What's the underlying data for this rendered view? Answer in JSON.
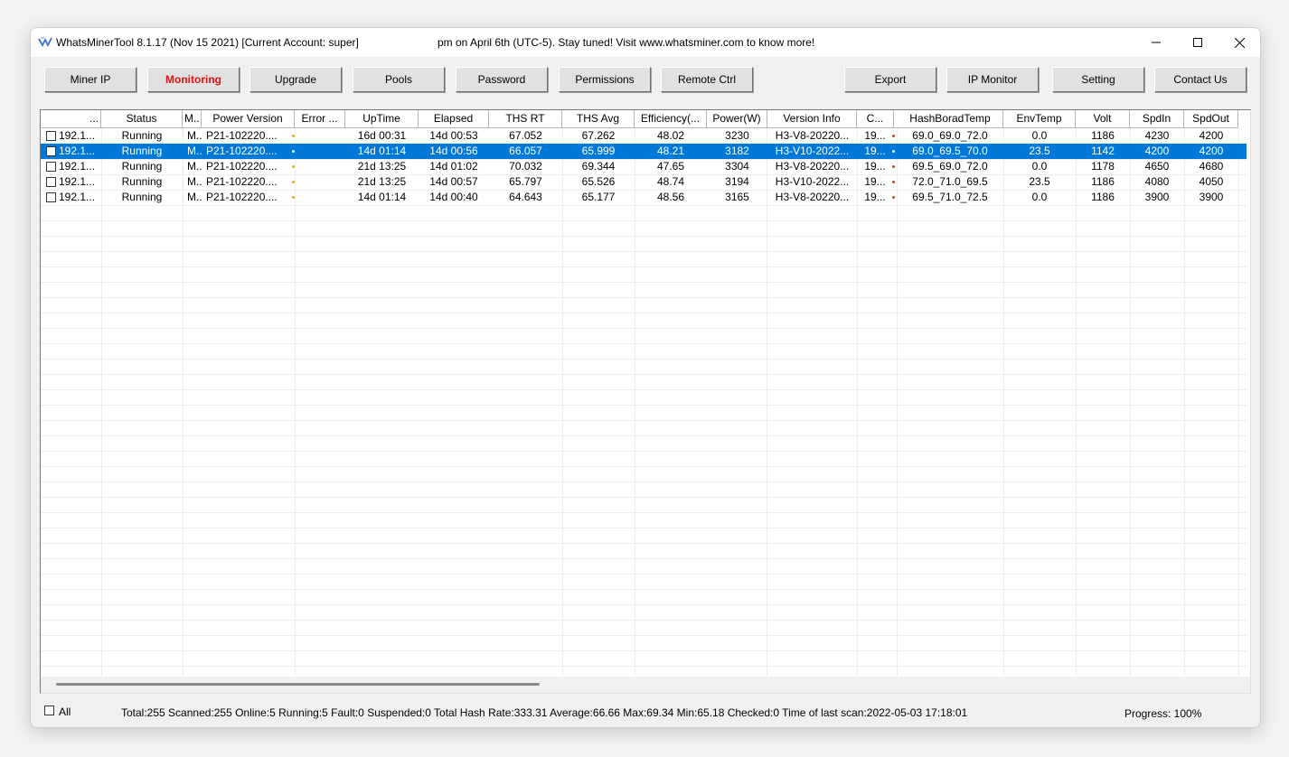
{
  "window": {
    "title": "WhatsMinerTool 8.1.17 (Nov 15 2021) [Current Account: super]",
    "marquee": "pm on April 6th (UTC-5). Stay tuned! Visit www.whatsminer.com to know more!"
  },
  "toolbar": [
    {
      "label": "Miner IP",
      "active": false
    },
    {
      "label": "Monitoring",
      "active": true
    },
    {
      "label": "Upgrade",
      "active": false
    },
    {
      "label": "Pools",
      "active": false
    },
    {
      "label": "Password",
      "active": false
    },
    {
      "label": "Permissions",
      "active": false
    },
    {
      "label": "Remote Ctrl",
      "active": false
    },
    {
      "label": "Export",
      "active": false
    },
    {
      "label": "IP Monitor",
      "active": false
    },
    {
      "label": "Setting",
      "active": false
    },
    {
      "label": "Contact Us",
      "active": false
    }
  ],
  "columns": [
    "...",
    "Status",
    "M..",
    "Power Version",
    "Error ...",
    "UpTime",
    "Elapsed",
    "THS RT",
    "THS Avg",
    "Efficiency(...",
    "Power(W)",
    "Version Info",
    "C...",
    "",
    "HashBoradTemp",
    "EnvTemp",
    "Volt",
    "SpdIn",
    "SpdOut"
  ],
  "rows": [
    {
      "ip": "192.1...",
      "status": "Running",
      "m": "M..",
      "power_version": "P21-102220....",
      "error": "",
      "uptime": "16d 00:31",
      "elapsed": "14d 00:53",
      "ths_rt": "67.052",
      "ths_avg": "67.262",
      "efficiency": "48.02",
      "power": "3230",
      "version": "H3-V8-20220...",
      "c": "19...",
      "hash_temp": "69.0_69.0_72.0",
      "env_temp": "0.0",
      "volt": "1186",
      "spd_in": "4230",
      "spd_out": "4200",
      "selected": false
    },
    {
      "ip": "192.1...",
      "status": "Running",
      "m": "M..",
      "power_version": "P21-102220....",
      "error": "",
      "uptime": "14d 01:14",
      "elapsed": "14d 00:56",
      "ths_rt": "66.057",
      "ths_avg": "65.999",
      "efficiency": "48.21",
      "power": "3182",
      "version": "H3-V10-2022...",
      "c": "19...",
      "hash_temp": "69.0_69.5_70.0",
      "env_temp": "23.5",
      "volt": "1142",
      "spd_in": "4200",
      "spd_out": "4200",
      "selected": true
    },
    {
      "ip": "192.1...",
      "status": "Running",
      "m": "M..",
      "power_version": "P21-102220....",
      "error": "",
      "uptime": "21d 13:25",
      "elapsed": "14d 01:02",
      "ths_rt": "70.032",
      "ths_avg": "69.344",
      "efficiency": "47.65",
      "power": "3304",
      "version": "H3-V8-20220...",
      "c": "19...",
      "hash_temp": "69.5_69.0_72.0",
      "env_temp": "0.0",
      "volt": "1178",
      "spd_in": "4650",
      "spd_out": "4680",
      "selected": false
    },
    {
      "ip": "192.1...",
      "status": "Running",
      "m": "M..",
      "power_version": "P21-102220....",
      "error": "",
      "uptime": "21d 13:25",
      "elapsed": "14d 00:57",
      "ths_rt": "65.797",
      "ths_avg": "65.526",
      "efficiency": "48.74",
      "power": "3194",
      "version": "H3-V10-2022...",
      "c": "19...",
      "hash_temp": "72.0_71.0_69.5",
      "env_temp": "23.5",
      "volt": "1186",
      "spd_in": "4080",
      "spd_out": "4050",
      "selected": false
    },
    {
      "ip": "192.1...",
      "status": "Running",
      "m": "M..",
      "power_version": "P21-102220....",
      "error": "",
      "uptime": "14d 01:14",
      "elapsed": "14d 00:40",
      "ths_rt": "64.643",
      "ths_avg": "65.177",
      "efficiency": "48.56",
      "power": "3165",
      "version": "H3-V8-20220...",
      "c": "19...",
      "hash_temp": "69.5_71.0_72.5",
      "env_temp": "0.0",
      "volt": "1186",
      "spd_in": "3900",
      "spd_out": "3900",
      "selected": false
    }
  ],
  "status_bar": {
    "all_label": "All",
    "summary": "Total:255  Scanned:255  Online:5  Running:5  Fault:0  Suspended:0  Total Hash Rate:333.31  Average:66.66  Max:69.34  Min:65.18  Checked:0  Time of last scan:2022-05-03 17:18:01",
    "progress": "Progress: 100%"
  },
  "colors": {
    "selection": "#0078d7",
    "active_tab_text": "#e01010",
    "window_bg": "#f0f0f0"
  }
}
